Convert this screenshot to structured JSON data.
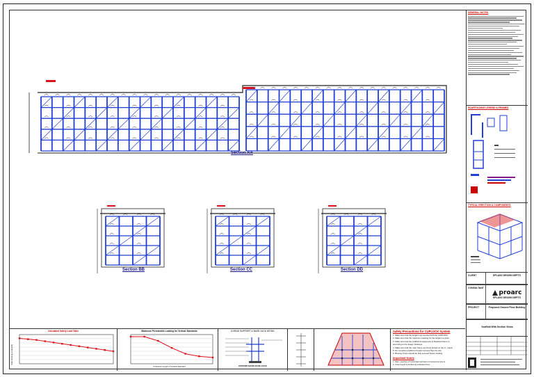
{
  "sections": {
    "aa": "Section AA",
    "bb": "Section BB",
    "cc": "Section CC",
    "dd": "Section DD"
  },
  "sidebar": {
    "general_notes_title": "GENERAL NOTES",
    "legend_title": "SCAFFOLDING LEGEND & FRAMES",
    "typical_title": "TYPICAL ERECTION & COMPONENTS",
    "title_rows": [
      {
        "label": "CLIENT",
        "value": "EPLASS DESIGN DEPTS"
      },
      {
        "label": "CONSULTANT",
        "value": "EPLASS DESIGN DEPTS"
      }
    ],
    "company": "proarc",
    "project_label": "PROJECT",
    "project_value": "Proposed Ground Floor Building",
    "drawing_title": "Scaffold With Section Views"
  },
  "bottom": {
    "chart1_title": "Calculated Safety Load Table",
    "chart1_ylabel": "Safe Working Load (kN)",
    "chart2_title": "Maximum Permissible Loading for Vertical Standards",
    "chart2_xlabel": "Unbraced Length of Vertical Standard",
    "jack_title": "U-HEAD SUPPORT & BASE JACK DETAIL",
    "jack_caption": "GROUND BASE BASE JACK",
    "safety_title": "Safety Precautions for CUPLOCK System",
    "safety_items": [
      "1. Make sure that the ledgers are secured with the CUPLOCK",
      "2. Make sure that the maximum spacing for the ledgers is given",
      "3. Make sure that the scaffold arrangement & Standard frame is",
      "   according to the design drawings",
      "4. Make sure that the main frame are firmly locked on the U - Head",
      "5. Do not add a scaffold of height not less than the site",
      "6. Bracing Tubes should be fully secured before loading"
    ],
    "important_title": "Important Notes",
    "important_items": [
      "1. Max. spacing of horizontal members in transverse line is",
      "2. Over-height is limited as indicated here"
    ]
  },
  "chart_data": [
    {
      "type": "line",
      "title": "Calculated Safety Load Table",
      "xlabel": "",
      "ylabel": "Safe Working Load (kN)",
      "x": [
        1,
        2,
        3,
        4,
        5,
        6,
        7,
        8,
        9,
        10,
        11,
        12
      ],
      "series": [
        {
          "values": [
            61,
            59,
            57,
            54,
            51,
            48,
            45,
            42,
            39,
            36,
            33,
            30
          ]
        }
      ],
      "ylim": [
        0,
        70
      ]
    },
    {
      "type": "line",
      "title": "Maximum Permissible Loading for Vertical Standards",
      "xlabel": "Unbraced Length of Vertical Standard",
      "ylabel": "",
      "x": [
        0.5,
        1.0,
        1.5,
        2.0,
        2.5,
        3.0,
        3.5
      ],
      "series": [
        {
          "values": [
            65,
            65,
            55,
            38,
            24,
            18,
            15
          ]
        }
      ],
      "ylim": [
        0,
        70
      ]
    }
  ],
  "colors": {
    "scaffold": "#1f3fd6",
    "line": "#e0101a",
    "frame": "#222222",
    "accent": "#c00000"
  }
}
